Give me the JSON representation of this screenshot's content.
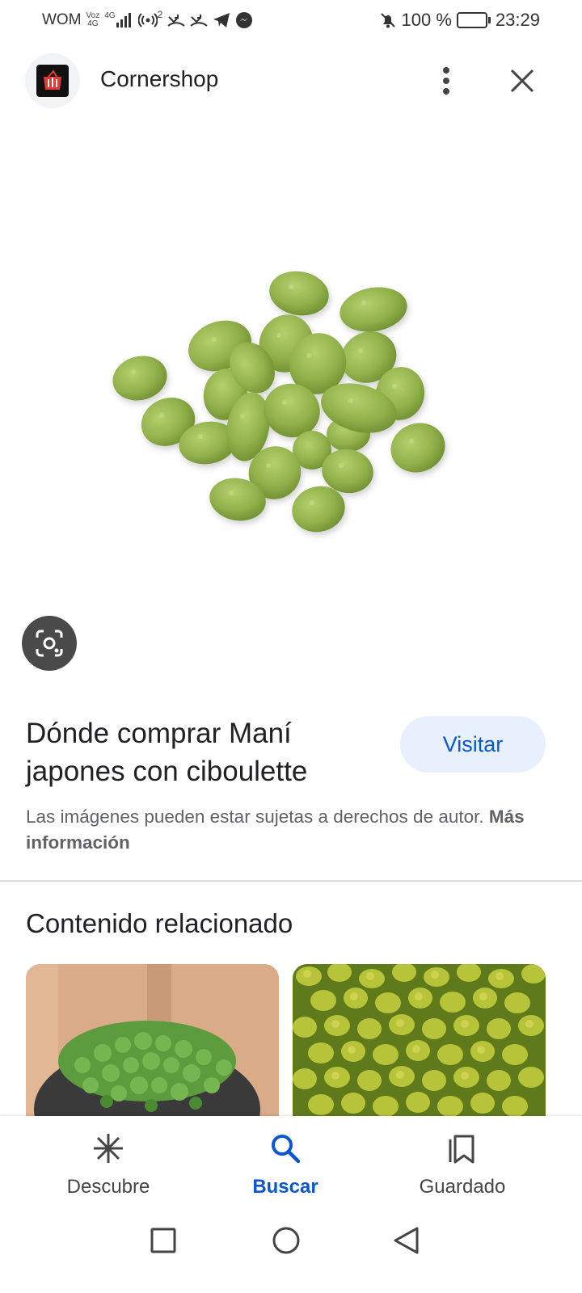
{
  "status_bar": {
    "carrier": "WOM",
    "network_top": "Voz",
    "network_bottom": "4G",
    "lte_top": "4G",
    "hotspot_count": "2",
    "battery": "100 %",
    "time": "23:29"
  },
  "header": {
    "app_name": "Cornershop",
    "more_icon": "more-vert-icon",
    "close_icon": "close-icon"
  },
  "product": {
    "title": "Dónde comprar Maní japones con ciboulette",
    "visit_label": "Visitar",
    "copyright_text": "Las imágenes pueden estar sujetas a derechos de autor.",
    "more_info_label": "Más información"
  },
  "related": {
    "title": "Contenido relacionado"
  },
  "bottom_nav": {
    "items": [
      {
        "label": "Descubre",
        "icon": "asterisk-icon",
        "active": false
      },
      {
        "label": "Buscar",
        "icon": "search-icon",
        "active": true
      },
      {
        "label": "Guardado",
        "icon": "bookmarks-icon",
        "active": false
      }
    ]
  },
  "colors": {
    "accent": "#0b57d0",
    "visit_bg": "#e8f0fe",
    "peanut_green": "#8fb04a"
  }
}
